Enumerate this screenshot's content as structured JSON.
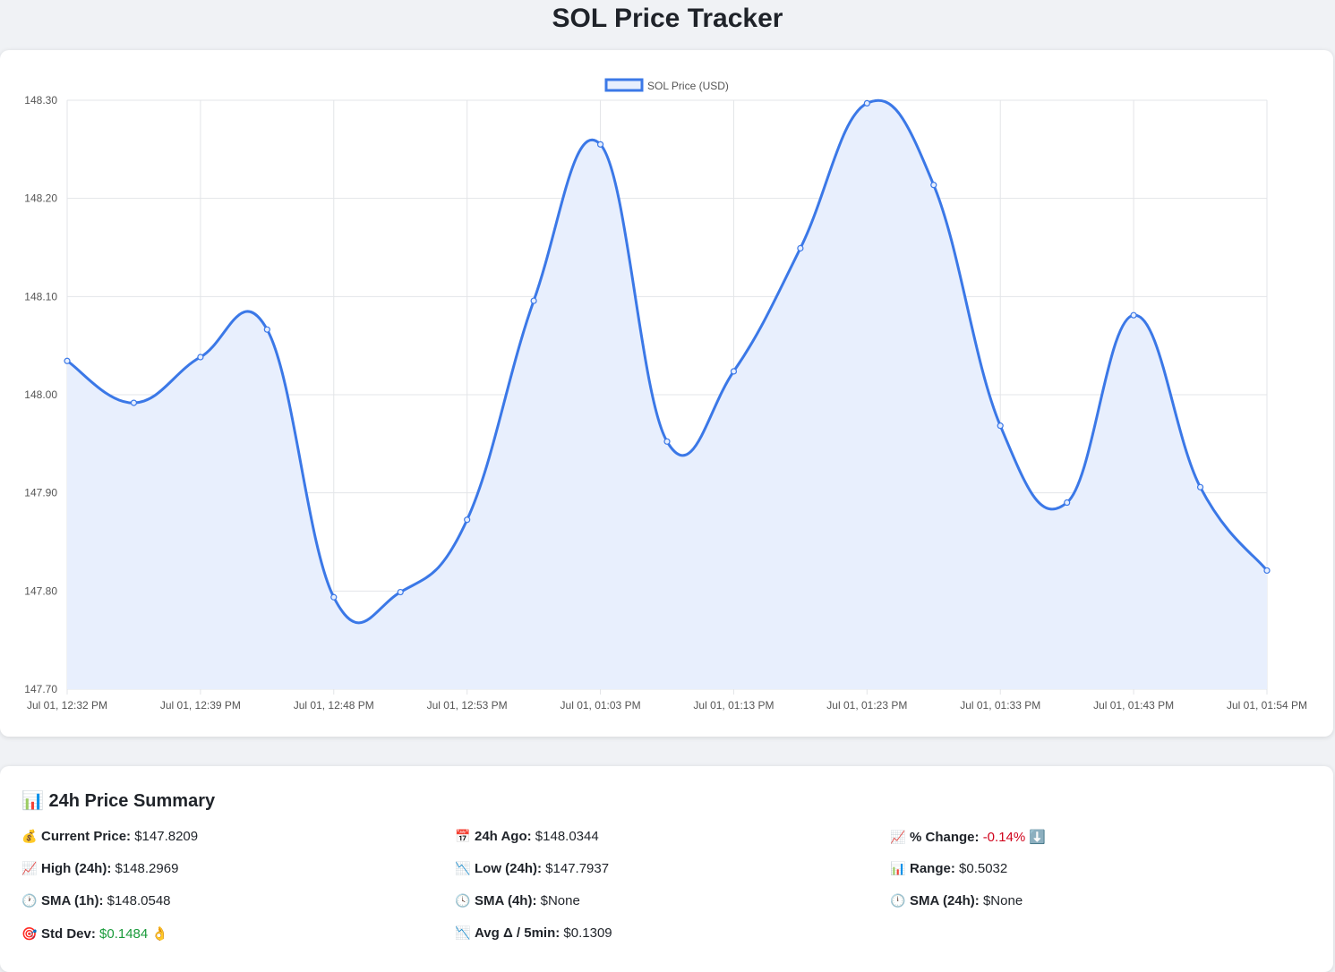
{
  "header": {
    "title": "SOL Price Tracker"
  },
  "chart_data": {
    "type": "area",
    "legend": "SOL Price (USD)",
    "legend_position": "top-center",
    "x_tick_labels": [
      "Jul 01, 12:32 PM",
      "Jul 01, 12:39 PM",
      "Jul 01, 12:48 PM",
      "Jul 01, 12:53 PM",
      "Jul 01, 01:03 PM",
      "Jul 01, 01:13 PM",
      "Jul 01, 01:23 PM",
      "Jul 01, 01:33 PM",
      "Jul 01, 01:43 PM",
      "Jul 01, 01:54 PM"
    ],
    "y_tick_labels": [
      "148.30",
      "148.20",
      "148.10",
      "148.00",
      "147.90",
      "147.80",
      "147.70"
    ],
    "ylim": [
      147.7,
      148.3
    ],
    "grid": true,
    "series": [
      {
        "name": "SOL Price (USD)",
        "values": [
          148.0344,
          147.9917,
          148.0383,
          148.0664,
          147.7937,
          147.7989,
          147.8726,
          148.0957,
          148.255,
          147.9523,
          148.0238,
          148.1492,
          148.2969,
          148.2137,
          147.9684,
          147.8901,
          148.081,
          147.9058,
          147.8209
        ]
      }
    ],
    "line_color": "#3b78e7",
    "fill_color": "#e8effd"
  },
  "summary": {
    "title": "24h Price Summary",
    "title_icon": "📊",
    "stats": [
      {
        "icon": "💰",
        "label": "Current Price:",
        "value": "$147.8209"
      },
      {
        "icon": "📅",
        "label": "24h Ago:",
        "value": "$148.0344"
      },
      {
        "icon": "📈",
        "label": "% Change:",
        "value": "-0.14%",
        "suffix": "⬇️"
      },
      {
        "icon": "📈",
        "label": "High (24h):",
        "value": "$148.2969"
      },
      {
        "icon": "📉",
        "label": "Low (24h):",
        "value": "$147.7937"
      },
      {
        "icon": "📊",
        "label": "Range:",
        "value": "$0.5032"
      },
      {
        "icon": "🕐",
        "label": "SMA (1h):",
        "value": "$148.0548"
      },
      {
        "icon": "🕓",
        "label": "SMA (4h):",
        "value": "$None"
      },
      {
        "icon": "🕛",
        "label": "SMA (24h):",
        "value": "$None"
      },
      {
        "icon": "🎯",
        "label": "Std Dev:",
        "value": "$0.1484",
        "suffix": "👌"
      },
      {
        "icon": "📉",
        "label": "Avg Δ / 5min:",
        "value": "$0.1309"
      }
    ],
    "colors": {
      "negative": "#d0021b",
      "positive": "#1a9b3b"
    }
  }
}
